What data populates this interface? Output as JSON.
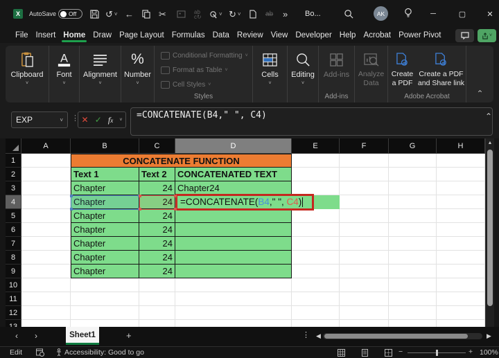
{
  "titlebar": {
    "autosave_label": "AutoSave",
    "autosave_state": "Off",
    "doc_title": "Bo...",
    "avatar_initials": "AK",
    "overflow": "»"
  },
  "menubar": {
    "items": [
      "File",
      "Insert",
      "Home",
      "Draw",
      "Page Layout",
      "Formulas",
      "Data",
      "Review",
      "View",
      "Developer",
      "Help",
      "Acrobat",
      "Power Pivot"
    ],
    "active_index": 2
  },
  "ribbon": {
    "clipboard": "Clipboard",
    "font": "Font",
    "alignment": "Alignment",
    "number": "Number",
    "styles_items": [
      "Conditional Formatting",
      "Format as Table",
      "Cell Styles"
    ],
    "styles_label": "Styles",
    "cells": "Cells",
    "editing": "Editing",
    "addins_item": "Add-ins",
    "addins_label": "Add-ins",
    "analyze": "Analyze Data",
    "pdf1": "Create a PDF",
    "pdf2": "Create a PDF and Share link",
    "acrobat_label": "Adobe Acrobat"
  },
  "formula_bar": {
    "name_box": "EXP",
    "formula": "=CONCATENATE(B4,\" \", C4)"
  },
  "grid": {
    "columns": [
      "A",
      "B",
      "C",
      "D",
      "E",
      "F",
      "G",
      "H"
    ],
    "selected_column": "D",
    "row_count": 13,
    "selected_row": 4,
    "title": "CONCATENATE FUNCTION",
    "col_headers": {
      "text1": "Text 1",
      "text2": "Text 2",
      "result": "CONCATENATED TEXT"
    },
    "rows": [
      {
        "text1": "Chapter",
        "text2": "24",
        "result": "Chapter24"
      },
      {
        "text1": "Chapter",
        "text2": "24",
        "result": ""
      },
      {
        "text1": "Chapter",
        "text2": "24",
        "result": ""
      },
      {
        "text1": "Chapter",
        "text2": "24",
        "result": ""
      },
      {
        "text1": "Chapter",
        "text2": "24",
        "result": ""
      },
      {
        "text1": "Chapter",
        "text2": "24",
        "result": ""
      },
      {
        "text1": "Chapter",
        "text2": "24",
        "result": ""
      }
    ],
    "edit_cell": {
      "p1": "=CONCATENATE(",
      "ref1": "B4",
      "p2": ",\" \", ",
      "ref2": "C4",
      "p3": ")"
    }
  },
  "tabbar": {
    "sheet_name": "Sheet1"
  },
  "statusbar": {
    "mode": "Edit",
    "accessibility": "Accessibility: Good to go",
    "zoom": "100%"
  },
  "colors": {
    "green_fill": "#7EDC8B",
    "orange_fill": "#EC7C32",
    "accent_green": "#107C41",
    "ref_blue": "#4A90D9",
    "ref_red": "#E05A4E",
    "edit_border": "#C5271F"
  }
}
